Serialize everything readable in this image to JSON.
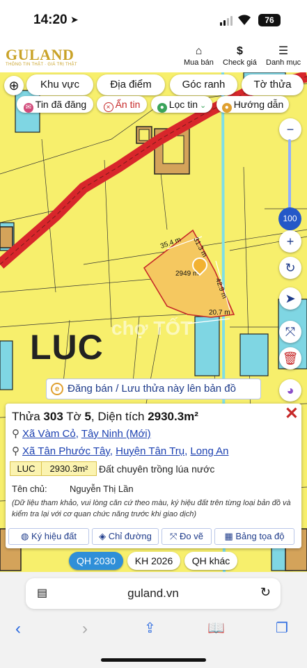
{
  "status": {
    "time": "14:20",
    "battery": "76"
  },
  "header": {
    "logo_name": "GULAND",
    "logo_tagline": "THÔNG TIN THẬT · GIÁ TRỊ THẬT",
    "nav": [
      {
        "label": "Mua bán",
        "icon": "house-icon"
      },
      {
        "label": "Check giá",
        "icon": "dollar-icon"
      },
      {
        "label": "Danh mục",
        "icon": "menu-icon"
      }
    ]
  },
  "toolbar": {
    "row1": [
      "Khu vực",
      "Địa điểm",
      "Góc ranh",
      "Tờ thửa"
    ],
    "row2": [
      "Tin đã đăng",
      "Ẩn tin",
      "Lọc tin",
      "Hướng dẫn"
    ]
  },
  "map": {
    "zoom": "100",
    "land_code_overlay": "LUC",
    "parcel_area_label": "2949 m²",
    "edges": [
      "35.4 m",
      "31.3 m",
      "42.9 m",
      "20.7 m"
    ],
    "watermark": "chợ TỐT"
  },
  "save_bar": {
    "label": "Đăng bán / Lưu thửa này lên bản đồ"
  },
  "parcel": {
    "title_prefix": "Thửa ",
    "parcel_no": "303",
    "sheet_prefix": " Tờ ",
    "sheet_no": "5",
    "area_prefix": ", Diện tích ",
    "area": "2930.3m²",
    "address1": [
      "Xã Vàm Cỏ",
      "Tây Ninh (Mới)"
    ],
    "address2": [
      "Xã Tân Phước Tây",
      "Huyện Tân Trụ",
      "Long An"
    ],
    "land_code": "LUC",
    "land_area": "2930.3m²",
    "land_type": "Đất chuyên trồng lúa nước",
    "owner_label": "Tên chủ:",
    "owner_name": "Nguyễn Thị Lần",
    "note": "(Dữ liệu tham khảo, vui lòng căn cứ theo màu, ký hiệu đất trên từng loại bản đồ và kiểm tra lại với cơ quan chức năng trước khi giao dịch)",
    "actions": [
      "Ký hiệu đất",
      "Chỉ đường",
      "Đo vẽ",
      "Bảng tọa độ"
    ]
  },
  "plan_tabs": [
    "QH 2030",
    "KH 2026",
    "QH khác"
  ],
  "browser": {
    "url": "guland.vn"
  },
  "colors": {
    "accent": "#2f8fd8",
    "road": "#d8262b",
    "land": "#f7ef6c",
    "parcel": "#f5c860"
  }
}
